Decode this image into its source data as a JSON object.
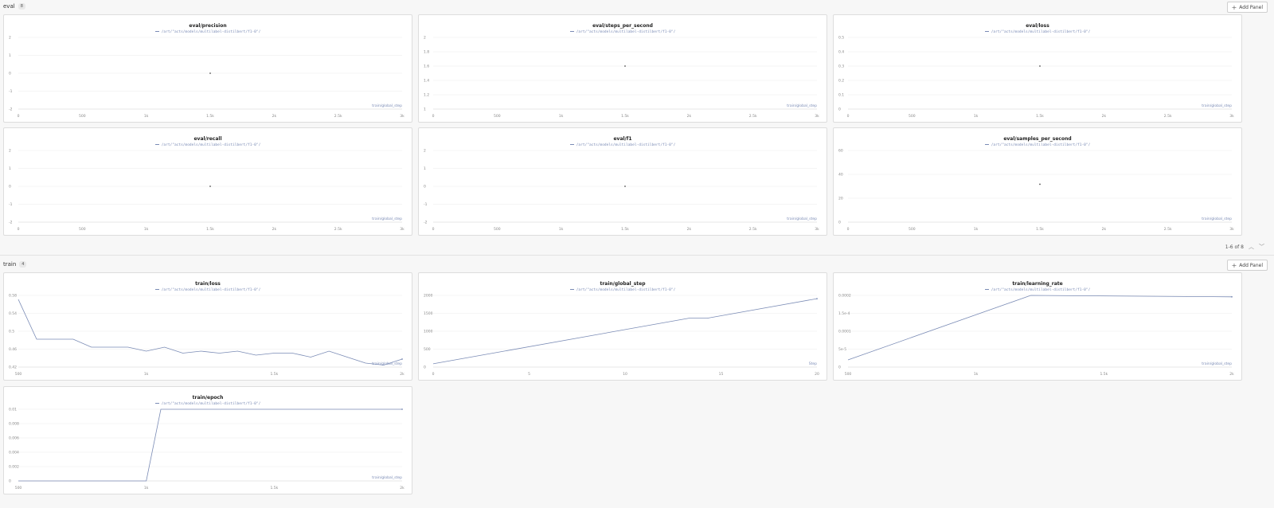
{
  "sections": {
    "eval": {
      "title": "eval",
      "count": "8",
      "add_panel_label": "Add Panel"
    },
    "train": {
      "title": "train",
      "count": "4",
      "add_panel_label": "Add Panel"
    }
  },
  "pagination": {
    "text": "1-6 of 8"
  },
  "run_name": "/art/\"acts/models/multilabel-distilbert/f1-0\"/",
  "panels": [
    {
      "id": "eval-precision",
      "title": "eval/precision",
      "xlabel": "train/global_step",
      "xticks": [
        "0",
        "500",
        "1k",
        "1.5k",
        "2k",
        "2.5k",
        "3k"
      ],
      "yticks": [
        "2",
        "1",
        "0",
        "-1",
        "-2"
      ]
    },
    {
      "id": "eval-steps",
      "title": "eval/steps_per_second",
      "xlabel": "train/global_step",
      "xticks": [
        "0",
        "500",
        "1k",
        "1.5k",
        "2k",
        "2.5k",
        "3k"
      ],
      "yticks": [
        "2",
        "1.8",
        "1.6",
        "1.4",
        "1.2",
        "1"
      ]
    },
    {
      "id": "eval-loss",
      "title": "eval/loss",
      "xlabel": "train/global_step",
      "xticks": [
        "0",
        "500",
        "1k",
        "1.5k",
        "2k",
        "2.5k",
        "3k"
      ],
      "yticks": [
        "0.5",
        "0.4",
        "0.3",
        "0.2",
        "0.1",
        "0"
      ]
    },
    {
      "id": "eval-recall",
      "title": "eval/recall",
      "xlabel": "train/global_step",
      "xticks": [
        "0",
        "500",
        "1k",
        "1.5k",
        "2k",
        "2.5k",
        "3k"
      ],
      "yticks": [
        "2",
        "1",
        "0",
        "-1",
        "-2"
      ]
    },
    {
      "id": "eval-f1",
      "title": "eval/f1",
      "xlabel": "train/global_step",
      "xticks": [
        "0",
        "500",
        "1k",
        "1.5k",
        "2k",
        "2.5k",
        "3k"
      ],
      "yticks": [
        "2",
        "1",
        "0",
        "-1",
        "-2"
      ]
    },
    {
      "id": "eval-samples",
      "title": "eval/samples_per_second",
      "xlabel": "train/global_step",
      "xticks": [
        "0",
        "500",
        "1k",
        "1.5k",
        "2k",
        "2.5k",
        "3k"
      ],
      "yticks": [
        "60",
        "40",
        "20",
        "0"
      ]
    },
    {
      "id": "train-loss",
      "title": "train/loss",
      "xlabel": "train/global_step",
      "xticks": [
        "500",
        "1k",
        "1.5k",
        "2k"
      ],
      "yticks": [
        "0.58",
        "0.54",
        "0.5",
        "0.46",
        "0.42"
      ]
    },
    {
      "id": "train-global-step",
      "title": "train/global_step",
      "xlabel": "Step",
      "xticks": [
        "0",
        "5",
        "10",
        "15",
        "20"
      ],
      "yticks": [
        "2000",
        "1500",
        "1000",
        "500",
        "0"
      ]
    },
    {
      "id": "train-lr",
      "title": "train/learning_rate",
      "xlabel": "train/global_step",
      "xticks": [
        "500",
        "1k",
        "1.5k",
        "2k"
      ],
      "yticks": [
        "0.0002",
        "1.5e-4",
        "0.0001",
        "5e-5",
        "0"
      ]
    },
    {
      "id": "train-epoch",
      "title": "train/epoch",
      "xlabel": "train/global_step",
      "xticks": [
        "500",
        "1k",
        "1.5k",
        "2k"
      ],
      "yticks": [
        "0.01",
        "0.008",
        "0.006",
        "0.004",
        "0.002",
        "0"
      ]
    }
  ],
  "chart_data": [
    {
      "type": "scatter",
      "title": "eval/precision",
      "xlabel": "train/global_step",
      "xlim": [
        0,
        3000
      ],
      "ylim": [
        -2,
        2
      ],
      "series": [
        {
          "x": [
            1500
          ],
          "y": [
            0
          ]
        }
      ]
    },
    {
      "type": "scatter",
      "title": "eval/steps_per_second",
      "xlabel": "train/global_step",
      "xlim": [
        0,
        3000
      ],
      "ylim": [
        1,
        2
      ],
      "series": [
        {
          "x": [
            1500
          ],
          "y": [
            1.6
          ]
        }
      ]
    },
    {
      "type": "scatter",
      "title": "eval/loss",
      "xlabel": "train/global_step",
      "xlim": [
        0,
        3000
      ],
      "ylim": [
        0,
        0.5
      ],
      "series": [
        {
          "x": [
            1500
          ],
          "y": [
            0.3
          ]
        }
      ]
    },
    {
      "type": "scatter",
      "title": "eval/recall",
      "xlabel": "train/global_step",
      "xlim": [
        0,
        3000
      ],
      "ylim": [
        -2,
        2
      ],
      "series": [
        {
          "x": [
            1500
          ],
          "y": [
            0
          ]
        }
      ]
    },
    {
      "type": "scatter",
      "title": "eval/f1",
      "xlabel": "train/global_step",
      "xlim": [
        0,
        3000
      ],
      "ylim": [
        -2,
        2
      ],
      "series": [
        {
          "x": [
            1500
          ],
          "y": [
            0
          ]
        }
      ]
    },
    {
      "type": "scatter",
      "title": "eval/samples_per_second",
      "xlabel": "train/global_step",
      "xlim": [
        0,
        3000
      ],
      "ylim": [
        0,
        70
      ],
      "series": [
        {
          "x": [
            1500
          ],
          "y": [
            37
          ]
        }
      ]
    },
    {
      "type": "line",
      "title": "train/loss",
      "xlabel": "train/global_step",
      "xlim": [
        0,
        2100
      ],
      "ylim": [
        0.42,
        0.6
      ],
      "series": [
        {
          "x": [
            0,
            100,
            200,
            300,
            400,
            500,
            600,
            700,
            800,
            900,
            1000,
            1100,
            1200,
            1300,
            1400,
            1500,
            1600,
            1700,
            1800,
            1900,
            2000,
            2100
          ],
          "y": [
            0.59,
            0.49,
            0.49,
            0.49,
            0.47,
            0.47,
            0.47,
            0.46,
            0.47,
            0.455,
            0.46,
            0.455,
            0.46,
            0.45,
            0.455,
            0.455,
            0.445,
            0.46,
            0.445,
            0.43,
            0.425,
            0.44
          ]
        }
      ]
    },
    {
      "type": "line",
      "title": "train/global_step",
      "xlabel": "Step",
      "xlim": [
        0,
        21
      ],
      "ylim": [
        0,
        2200
      ],
      "series": [
        {
          "x": [
            0,
            14,
            15,
            21
          ],
          "y": [
            100,
            1500,
            1500,
            2100
          ]
        }
      ]
    },
    {
      "type": "line",
      "title": "train/learning_rate",
      "xlabel": "train/global_step",
      "xlim": [
        0,
        2100
      ],
      "ylim": [
        0,
        0.0002
      ],
      "series": [
        {
          "x": [
            0,
            1000,
            2100
          ],
          "y": [
            2e-05,
            0.0002,
            0.000196
          ]
        }
      ]
    },
    {
      "type": "line",
      "title": "train/epoch",
      "xlabel": "train/global_step",
      "xlim": [
        0,
        2100
      ],
      "ylim": [
        0,
        0.01
      ],
      "series": [
        {
          "x": [
            0,
            700,
            780,
            2100
          ],
          "y": [
            0,
            0,
            0.01,
            0.01
          ]
        }
      ]
    }
  ],
  "colors": {
    "series": "#7a8bb5",
    "grid": "#ececec"
  }
}
